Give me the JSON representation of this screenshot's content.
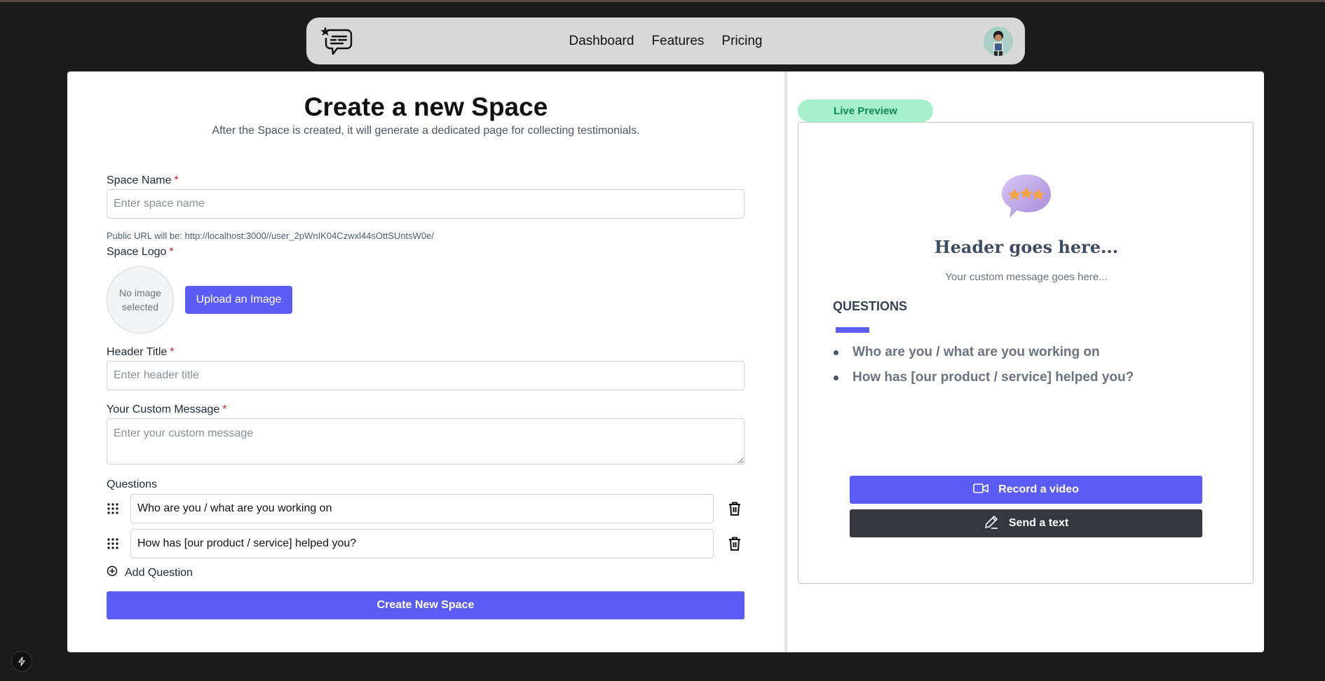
{
  "nav": {
    "links": [
      "Dashboard",
      "Features",
      "Pricing"
    ]
  },
  "form": {
    "title": "Create a new Space",
    "subtitle": "After the Space is created, it will generate a dedicated page for collecting testimonials.",
    "space_name_label": "Space Name",
    "space_name_placeholder": "Enter space name",
    "public_url": "Public URL will be: http://localhost:3000//user_2pWnIK04Czwxl44sOttSUntsW0e/",
    "space_logo_label": "Space Logo",
    "no_image": "No image selected",
    "upload_label": "Upload an Image",
    "header_title_label": "Header Title",
    "header_title_placeholder": "Enter header title",
    "custom_message_label": "Your Custom Message",
    "custom_message_placeholder": "Enter your custom message",
    "questions_label": "Questions",
    "questions": [
      "Who are you / what are you working on",
      "How has [our product / service] helped you?"
    ],
    "add_question_label": "Add Question",
    "create_label": "Create New Space",
    "required_mark": "*"
  },
  "preview": {
    "badge": "Live Preview",
    "header": "Header goes here...",
    "message": "Your custom message goes here...",
    "questions_title": "QUESTIONS",
    "questions": [
      "Who are you / what are you working on",
      "How has [our product / service] helped you?"
    ],
    "record_label": "Record a video",
    "send_label": "Send a text"
  },
  "colors": {
    "accent": "#5b5bf5",
    "badge_bg": "#a7f0cc",
    "badge_text": "#0b8a56",
    "dark_button": "#34373d",
    "required": "#dc2626"
  }
}
